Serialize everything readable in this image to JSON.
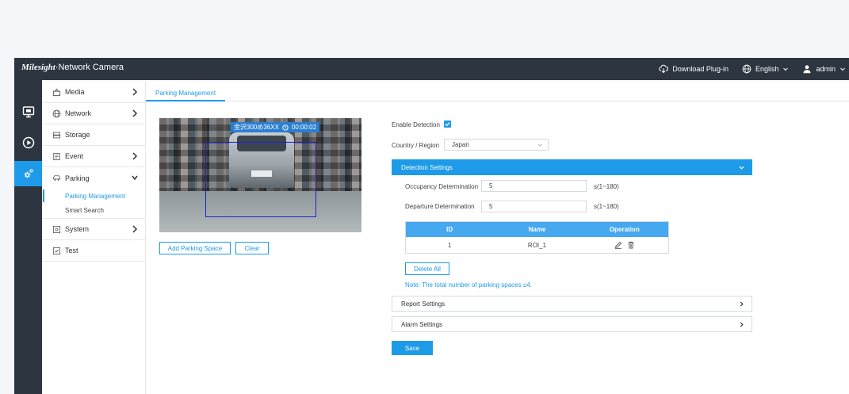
{
  "app": {
    "brand_logo": "Milesight",
    "title": "·Network Camera"
  },
  "header": {
    "download_plugin": "Download Plug-in",
    "language": "English",
    "user": "admin"
  },
  "icon_rail": [
    "live-view-icon",
    "playback-icon",
    "settings-icon"
  ],
  "sidebar": {
    "items": [
      {
        "label": "Media",
        "icon": "media-icon"
      },
      {
        "label": "Network",
        "icon": "globe-icon"
      },
      {
        "label": "Storage",
        "icon": "storage-icon"
      },
      {
        "label": "Event",
        "icon": "event-icon"
      },
      {
        "label": "Parking",
        "icon": "car-icon"
      },
      {
        "label": "System",
        "icon": "system-icon"
      },
      {
        "label": "Test",
        "icon": "test-icon"
      }
    ],
    "parking_sub": [
      "Parking Management",
      "Smart Search"
    ]
  },
  "tabs": {
    "active": "Parking Management"
  },
  "video": {
    "plate_text": "金沢300め36XX",
    "timer": "00:00:02"
  },
  "video_buttons": {
    "add": "Add Parking Space",
    "clear": "Clear"
  },
  "form": {
    "enable_detection_label": "Enable Detection",
    "enable_detection_checked": true,
    "country_label": "Country / Region",
    "country_value": "Japan",
    "detection_settings": "Detection Settings",
    "occupancy_label": "Occupancy Determination",
    "occupancy_value": "5",
    "occupancy_unit": "s(1~180)",
    "departure_label": "Departure Determination",
    "departure_value": "5",
    "departure_unit": "s(1~180)",
    "table": {
      "headers": [
        "ID",
        "Name",
        "Operation"
      ],
      "rows": [
        {
          "id": "1",
          "name": "ROI_1"
        }
      ]
    },
    "delete_all": "Delete All",
    "note": "Note: The total number of parking spaces ≤4.",
    "report_settings": "Report Settings",
    "alarm_settings": "Alarm Settings",
    "save": "Save"
  },
  "colors": {
    "accent": "#1d9ae8",
    "topbar": "#2d3540",
    "table_header": "#46a9f0"
  }
}
